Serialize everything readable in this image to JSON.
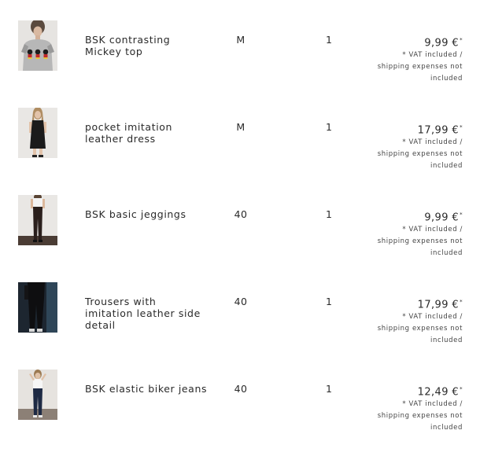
{
  "items": [
    {
      "name": "BSK contrasting\nMickey top",
      "size": "M",
      "qty": "1",
      "price": "9,99 €",
      "asterisk": "*",
      "note": "* VAT included /\nshipping expenses not\nincluded",
      "thumbnail": "grey-mickey-top"
    },
    {
      "name": "pocket imitation\nleather dress",
      "size": "M",
      "qty": "1",
      "price": "17,99 €",
      "asterisk": "*",
      "note": "* VAT included /\nshipping expenses not\nincluded",
      "thumbnail": "black-leather-dress"
    },
    {
      "name": "BSK basic jeggings",
      "size": "40",
      "qty": "1",
      "price": "9,99 €",
      "asterisk": "*",
      "note": "* VAT included /\nshipping expenses not\nincluded",
      "thumbnail": "black-jeggings"
    },
    {
      "name": "Trousers with\nimitation leather side\ndetail",
      "size": "40",
      "qty": "1",
      "price": "17,99 €",
      "asterisk": "*",
      "note": "* VAT included /\nshipping expenses not\nincluded",
      "thumbnail": "black-trousers"
    },
    {
      "name": "BSK elastic biker jeans",
      "size": "40",
      "qty": "1",
      "price": "12,49 €",
      "asterisk": "*",
      "note": "* VAT included /\nshipping expenses not\nincluded",
      "thumbnail": "biker-jeans"
    }
  ]
}
